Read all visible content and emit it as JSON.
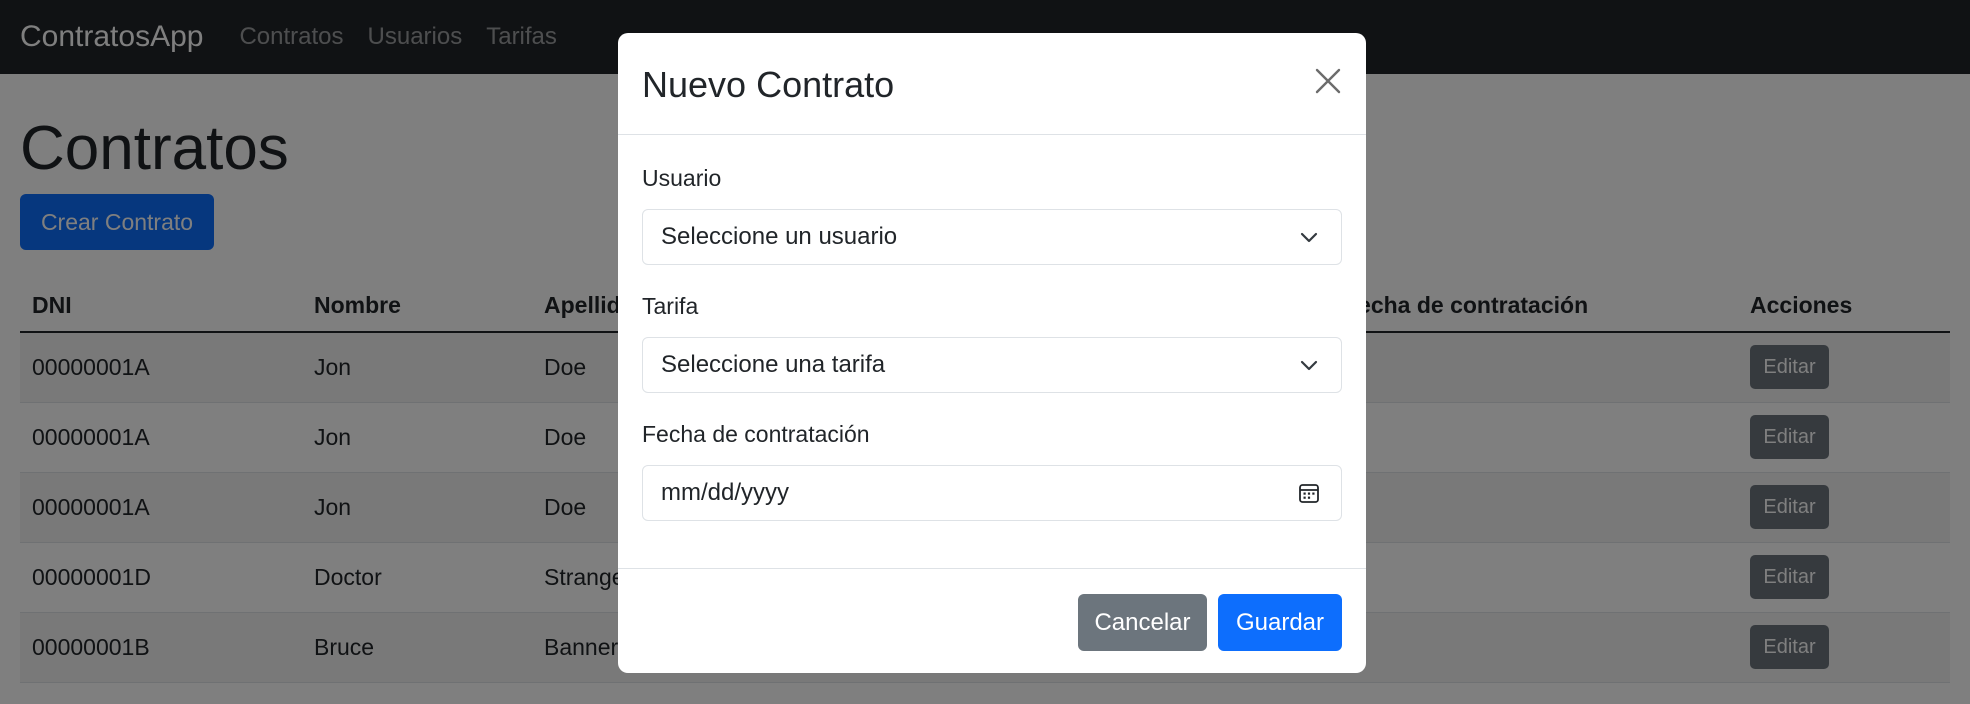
{
  "navbar": {
    "brand": "ContratosApp",
    "links": [
      "Contratos",
      "Usuarios",
      "Tarifas"
    ]
  },
  "page": {
    "title": "Contratos",
    "create_button": "Crear Contrato"
  },
  "table": {
    "headers": [
      "DNI",
      "Nombre",
      "Apellido",
      "",
      "Fecha de contratación",
      "Acciones"
    ],
    "rows": [
      {
        "dni": "00000001A",
        "nombre": "Jon",
        "apellido": "Doe",
        "action": "Editar"
      },
      {
        "dni": "00000001A",
        "nombre": "Jon",
        "apellido": "Doe",
        "action": "Editar"
      },
      {
        "dni": "00000001A",
        "nombre": "Jon",
        "apellido": "Doe",
        "action": "Editar"
      },
      {
        "dni": "00000001D",
        "nombre": "Doctor",
        "apellido": "Strange",
        "action": "Editar"
      },
      {
        "dni": "00000001B",
        "nombre": "Bruce",
        "apellido": "Banner",
        "action": "Editar"
      }
    ]
  },
  "modal": {
    "title": "Nuevo Contrato",
    "fields": {
      "usuario": {
        "label": "Usuario",
        "value": "Seleccione un usuario"
      },
      "tarifa": {
        "label": "Tarifa",
        "value": "Seleccione una tarifa"
      },
      "fecha": {
        "label": "Fecha de contratación",
        "placeholder": "mm/dd/yyyy"
      }
    },
    "cancel_button": "Cancelar",
    "save_button": "Guardar"
  },
  "colors": {
    "primary": "#0d6efd",
    "secondary": "#6c757d",
    "navbar": "#212529"
  },
  "icons": {
    "close": "close-icon",
    "select": "chevron-down-icon",
    "date": "calendar-icon"
  }
}
